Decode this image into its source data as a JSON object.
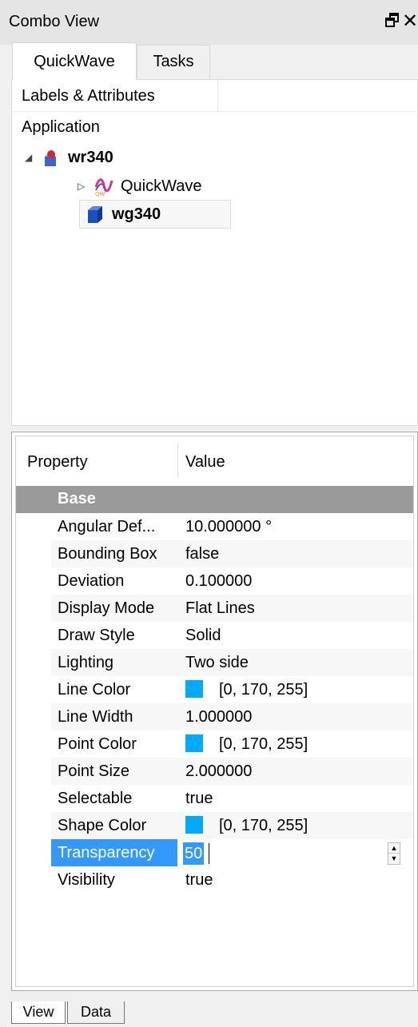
{
  "window": {
    "title": "Combo View"
  },
  "tabs": [
    {
      "label": "QuickWave",
      "active": true
    },
    {
      "label": "Tasks",
      "active": false
    }
  ],
  "tree": {
    "header": "Labels & Attributes",
    "root": "Application",
    "items": [
      {
        "label": "wr340",
        "bold": true,
        "expander": "expanded",
        "icon": "part-icon"
      },
      {
        "label": "QuickWave",
        "bold": false,
        "expander": "collapsed",
        "icon": "quickwave-icon"
      },
      {
        "label": "wg340",
        "bold": true,
        "expander": "none",
        "icon": "box-icon"
      }
    ]
  },
  "properties": {
    "header_property": "Property",
    "header_value": "Value",
    "group": "Base",
    "rows": [
      {
        "name": "Angular Def...",
        "value": "10.000000 °"
      },
      {
        "name": "Bounding Box",
        "value": "false"
      },
      {
        "name": "Deviation",
        "value": "0.100000"
      },
      {
        "name": "Display Mode",
        "value": "Flat Lines"
      },
      {
        "name": "Draw Style",
        "value": "Solid"
      },
      {
        "name": "Lighting",
        "value": "Two side"
      },
      {
        "name": "Line Color",
        "value": "[0, 170, 255]",
        "color": "#00aaff"
      },
      {
        "name": "Line Width",
        "value": "1.000000"
      },
      {
        "name": "Point Color",
        "value": "[0, 170, 255]",
        "color": "#00aaff"
      },
      {
        "name": "Point Size",
        "value": "2.000000"
      },
      {
        "name": "Selectable",
        "value": "true"
      },
      {
        "name": "Shape Color",
        "value": "[0, 170, 255]",
        "color": "#00aaff"
      },
      {
        "name": "Transparency",
        "value": "50",
        "selected": true
      },
      {
        "name": "Visibility",
        "value": "true"
      }
    ]
  },
  "bottom_tabs": [
    {
      "label": "View",
      "active": true
    },
    {
      "label": "Data",
      "active": false
    }
  ],
  "colors": {
    "selection": "#3399ff",
    "swatch": "#00aaff",
    "group_header": "#9a9a9a"
  }
}
